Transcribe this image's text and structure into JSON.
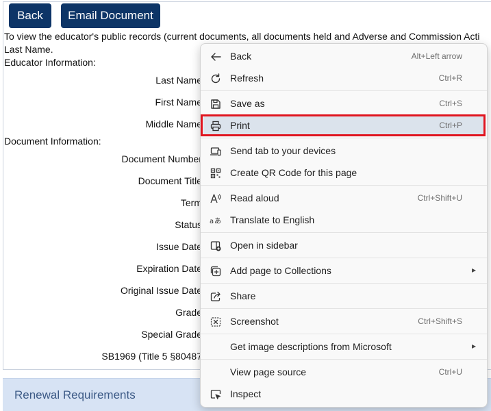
{
  "toolbar": {
    "back_label": "Back",
    "email_label": "Email Document"
  },
  "content": {
    "intro": "To view the educator's public records (current documents, all documents held and Adverse and Commission Acti",
    "last_name_line": "Last Name.",
    "educator_heading": "Educator Information:",
    "educator_fields": [
      "Last Name",
      "First Name",
      "Middle Name"
    ],
    "document_heading": "Document Information:",
    "document_fields": [
      "Document Number",
      "Document Title",
      "Term",
      "Status",
      "Issue Date",
      "Expiration Date",
      "Original Issue Date",
      "Grade",
      "Special Grade",
      "SB1969 (Title 5 §80487"
    ]
  },
  "renewal": {
    "label": "Renewal Requirements"
  },
  "context_menu": {
    "items": [
      {
        "label": "Back",
        "shortcut": "Alt+Left arrow",
        "icon": "arrow-left-icon"
      },
      {
        "label": "Refresh",
        "shortcut": "Ctrl+R",
        "icon": "refresh-icon"
      },
      {
        "label": "Save as",
        "shortcut": "Ctrl+S",
        "icon": "save-icon"
      },
      {
        "label": "Print",
        "shortcut": "Ctrl+P",
        "icon": "print-icon"
      },
      {
        "label": "Send tab to your devices",
        "shortcut": "",
        "icon": "devices-icon"
      },
      {
        "label": "Create QR Code for this page",
        "shortcut": "",
        "icon": "qr-code-icon"
      },
      {
        "label": "Read aloud",
        "shortcut": "Ctrl+Shift+U",
        "icon": "read-aloud-icon"
      },
      {
        "label": "Translate to English",
        "shortcut": "",
        "icon": "translate-icon"
      },
      {
        "label": "Open in sidebar",
        "shortcut": "",
        "icon": "sidebar-icon"
      },
      {
        "label": "Add page to Collections",
        "shortcut": "",
        "icon": "collections-icon"
      },
      {
        "label": "Share",
        "shortcut": "",
        "icon": "share-icon"
      },
      {
        "label": "Screenshot",
        "shortcut": "Ctrl+Shift+S",
        "icon": "screenshot-icon"
      },
      {
        "label": "Get image descriptions from Microsoft",
        "shortcut": "",
        "icon": ""
      },
      {
        "label": "View page source",
        "shortcut": "Ctrl+U",
        "icon": ""
      },
      {
        "label": "Inspect",
        "shortcut": "",
        "icon": "inspect-icon"
      }
    ],
    "selected_index": 3
  },
  "colors": {
    "button_bg": "#0d3567",
    "highlight_border": "#e0141e",
    "selected_item_bg": "#dbe3ec",
    "renewal_bg": "#d7e3f4"
  }
}
